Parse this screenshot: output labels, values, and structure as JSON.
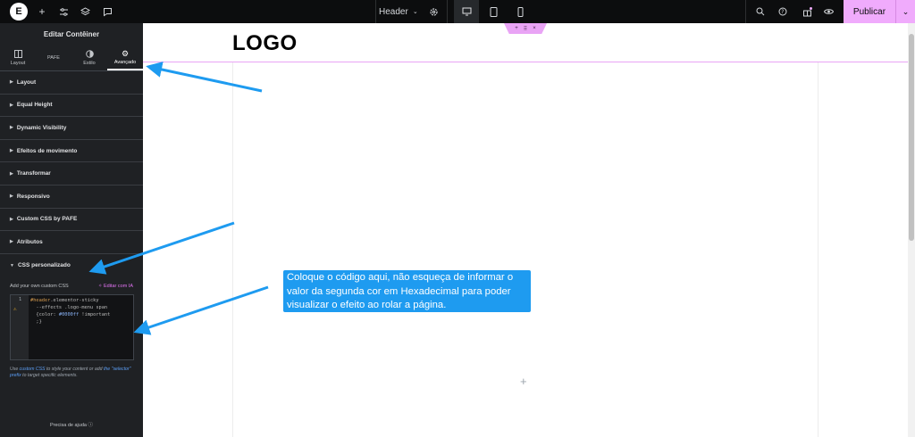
{
  "topbar": {
    "document_name": "Header",
    "publish_label": "Publicar",
    "accent_color": "#f0abfc"
  },
  "panel": {
    "title": "Editar Contêiner",
    "tabs": [
      {
        "label": "Layout",
        "icon": "layout-icon"
      },
      {
        "label": "PAFE",
        "icon": "pafe-icon"
      },
      {
        "label": "Estilo",
        "icon": "style-icon"
      },
      {
        "label": "Avançado",
        "icon": "gear-icon",
        "active": true
      }
    ],
    "sections": [
      "Layout",
      "Equal Height",
      "Dynamic Visibility",
      "Efeitos de movimento",
      "Transformar",
      "Responsivo",
      "Custom CSS by PAFE",
      "Atributos",
      "CSS personalizado"
    ],
    "css": {
      "label": "Add your own custom CSS",
      "ai_button": "Editar com IA",
      "line_number": "1",
      "code_line1_selector": "#header",
      "code_line1_rest": ".elementor-sticky",
      "code_line2": "--effects .logo-menu span",
      "code_line3_a": "{color: ",
      "code_line3_hex": "#0000ff",
      "code_line3_b": " !important",
      "code_line4": ";}",
      "help_prefix": "Use ",
      "help_link1": "custom CSS",
      "help_mid": " to style your content or add ",
      "help_link2": "the \"selector\" prefix",
      "help_suffix": " to target specific elements."
    },
    "need_help": "Precisa de ajuda"
  },
  "canvas": {
    "logo": "LOGO"
  },
  "callout": {
    "text": "Coloque o código aqui, não esqueça de informar o valor da segunda cor em Hexadecimal para poder visualizar o efeito ao rolar a página.",
    "color": "#1e9bf0"
  }
}
